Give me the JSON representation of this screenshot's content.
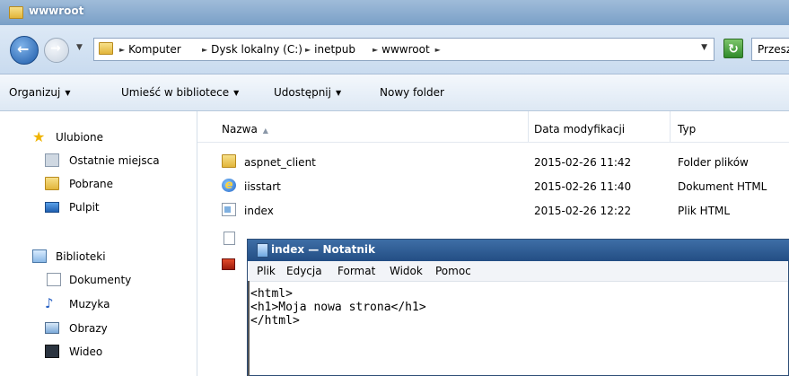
{
  "window": {
    "title": "wwwroot"
  },
  "address": {
    "crumbs": [
      "Komputer",
      "Dysk lokalny (C:)",
      "inetpub",
      "wwwroot"
    ],
    "search_placeholder": "Przeszuk"
  },
  "toolbar": {
    "organize": "Organizuj",
    "include_library": "Umieść w bibliotece",
    "share": "Udostępnij",
    "new_folder": "Nowy folder"
  },
  "nav": {
    "favorites_header": "Ulubione",
    "favorites": [
      "Ostatnie miejsca",
      "Pobrane",
      "Pulpit"
    ],
    "libraries_header": "Biblioteki",
    "libraries": [
      "Dokumenty",
      "Muzyka",
      "Obrazy",
      "Wideo"
    ]
  },
  "columns": {
    "name": "Nazwa",
    "date": "Data modyfikacji",
    "type": "Typ"
  },
  "files": [
    {
      "name": "aspnet_client",
      "date": "2015-02-26 11:42",
      "type": "Folder plików",
      "icon": "folder-icon"
    },
    {
      "name": "iisstart",
      "date": "2015-02-26 11:40",
      "type": "Dokument HTML",
      "icon": "ie-icon"
    },
    {
      "name": "index",
      "date": "2015-02-26 12:22",
      "type": "Plik HTML",
      "icon": "html-file-icon"
    }
  ],
  "notepad": {
    "title": "index — Notatnik",
    "menu": [
      "Plik",
      "Edycja",
      "Format",
      "Widok",
      "Pomoc"
    ],
    "content": "<html>\n<h1>Moja nowa strona</h1>\n</html>"
  }
}
